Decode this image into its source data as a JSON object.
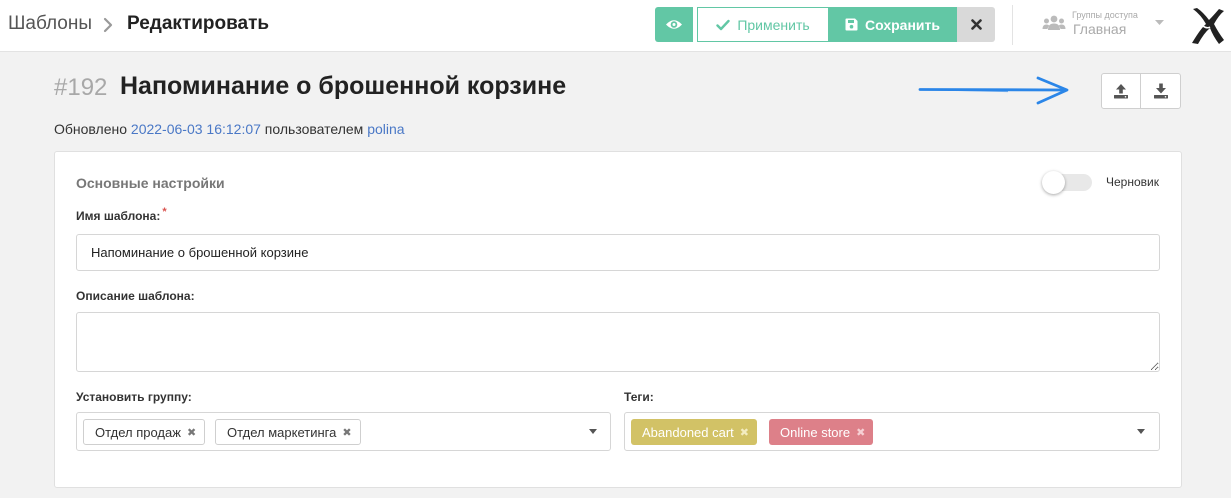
{
  "breadcrumb": {
    "root": "Шаблоны",
    "current": "Редактировать"
  },
  "toolbar": {
    "view_icon": "eye-icon",
    "apply_label": "Применить",
    "save_label": "Сохранить",
    "close_icon": "close-icon"
  },
  "access": {
    "label": "Группы доступа",
    "value": "Главная"
  },
  "template": {
    "id": "#192",
    "title": "Напоминание о брошенной корзине",
    "updated_prefix": "Обновлено",
    "updated_at": "2022-06-03 16:12:07",
    "updated_by_prefix": "пользователем",
    "updated_by": "polina"
  },
  "actions": {
    "upload_icon": "upload-icon",
    "download_icon": "download-icon"
  },
  "card": {
    "heading": "Основные настройки",
    "draft_label": "Черновик",
    "draft_on": false,
    "name_label": "Имя шаблона:",
    "required_mark": "*",
    "name_value": "Напоминание о брошенной корзине",
    "description_label": "Описание шаблона:",
    "description_value": "",
    "group_label": "Установить группу:",
    "groups": [
      "Отдел продаж",
      "Отдел маркетинга"
    ],
    "tags_label": "Теги:",
    "tags": [
      "Abandoned cart",
      "Online store"
    ]
  },
  "colors": {
    "accent": "#62c7a5",
    "link": "#4a78c6",
    "tag_yellow": "#d2c266",
    "tag_pink": "#dd8089",
    "arrow": "#2b86e8"
  }
}
